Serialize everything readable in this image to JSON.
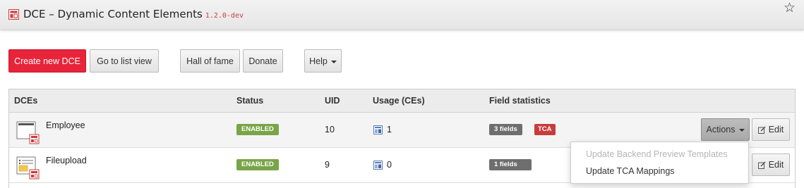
{
  "header": {
    "title": "DCE – Dynamic Content Elements",
    "version": "1.2.0-dev",
    "logo_icon": "dce-module-icon",
    "bookmark_icon": "star-outline-icon"
  },
  "toolbar": {
    "create_label": "Create new DCE",
    "list_view_label": "Go to list view",
    "hall_of_fame_label": "Hall of fame",
    "donate_label": "Donate",
    "help_label": "Help"
  },
  "table": {
    "headers": {
      "dces": "DCEs",
      "status": "Status",
      "uid": "UID",
      "usage": "Usage (CEs)",
      "field_stats": "Field statistics"
    },
    "rows": [
      {
        "name": "Employee",
        "status": "ENABLED",
        "uid": "10",
        "usage": "1",
        "fields": "3 fields",
        "tca": "TCA",
        "icon": "content-element-text-icon"
      },
      {
        "name": "Fileupload",
        "status": "ENABLED",
        "uid": "9",
        "usage": "0",
        "fields": "1 fields",
        "icon": "content-element-list-icon"
      }
    ],
    "actions_label": "Actions",
    "edit_label": "Edit"
  },
  "actions_menu": {
    "items": [
      {
        "label": "Update Backend Preview Templates",
        "disabled": true
      },
      {
        "label": "Update TCA Mappings",
        "disabled": false
      }
    ]
  },
  "colors": {
    "primary": "#e8243a",
    "enabled_badge": "#79a548",
    "fields_badge": "#6e6e6e",
    "tca_badge": "#c83c3c",
    "version_text": "#c83c3c"
  }
}
